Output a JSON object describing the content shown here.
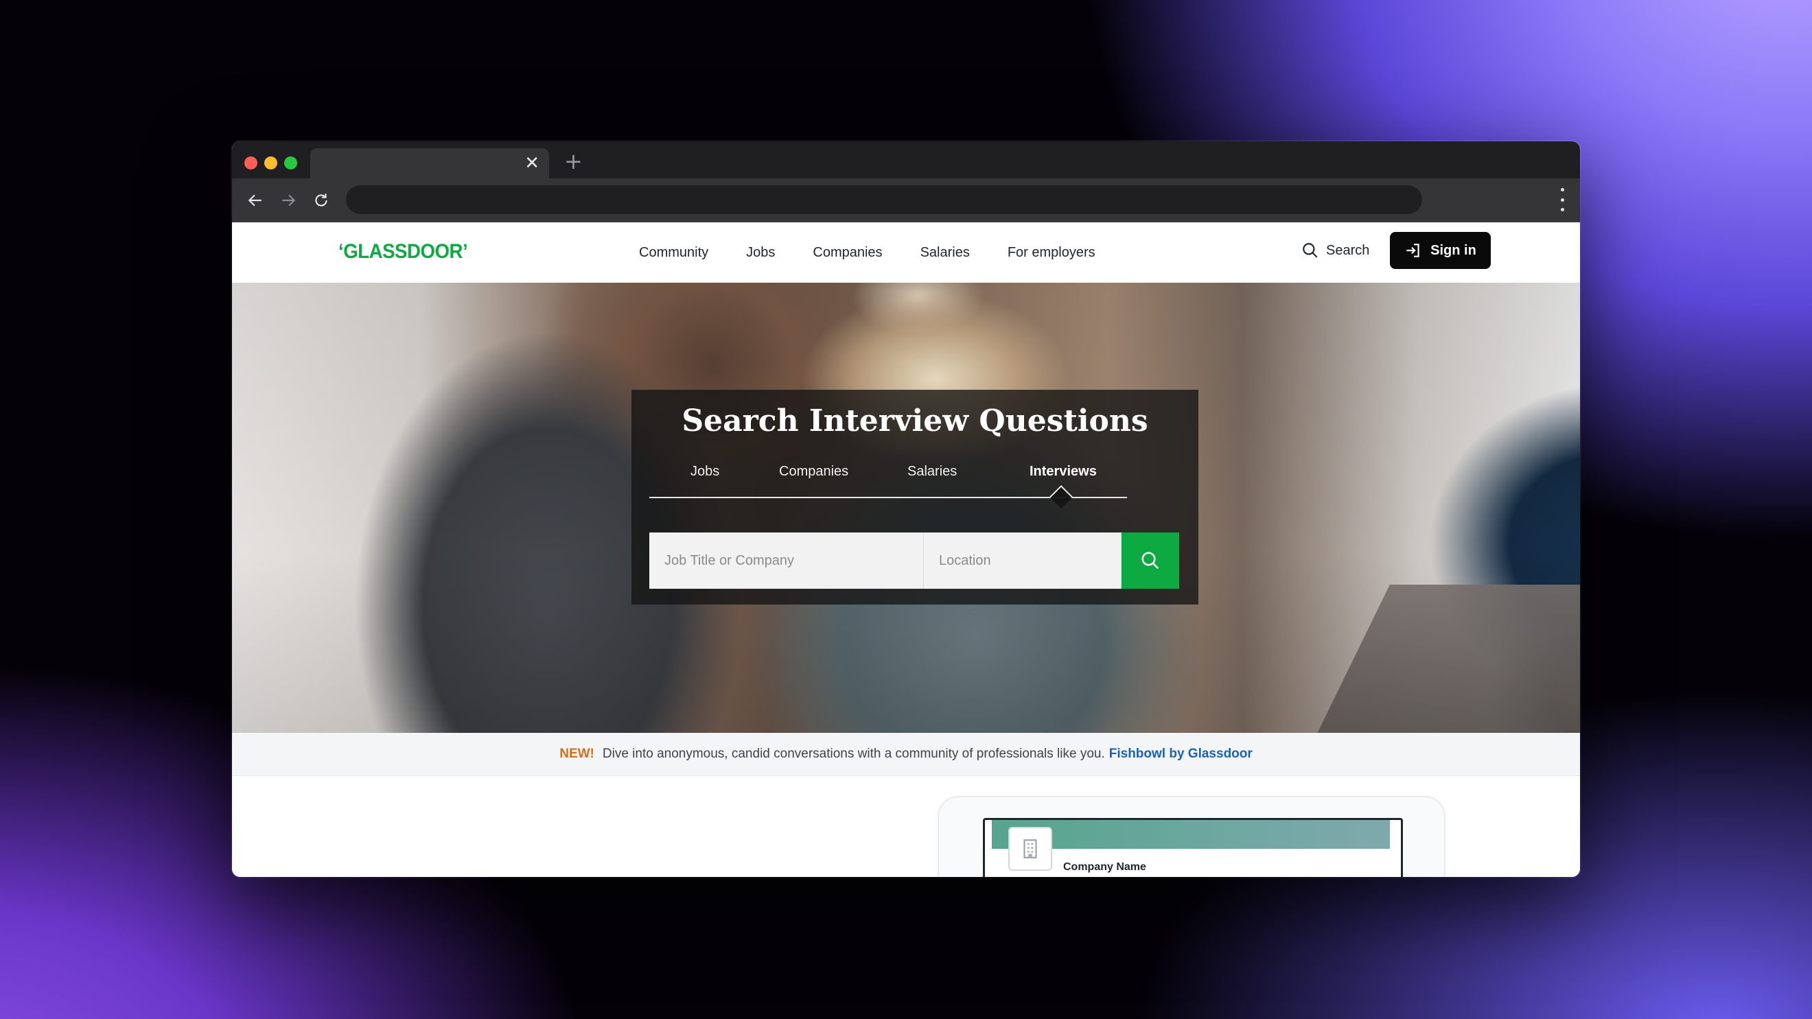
{
  "browser": {
    "tab_close_glyph": "✕",
    "new_tab_glyph": "+",
    "icons": [
      "back-arrow-icon",
      "forward-arrow-icon",
      "reload-icon",
      "kebab-menu-icon"
    ]
  },
  "header": {
    "logo": "GLASSDOOR",
    "nav": [
      "Community",
      "Jobs",
      "Companies",
      "Salaries",
      "For employers"
    ],
    "search_label": "Search",
    "signin_label": "Sign in"
  },
  "hero": {
    "title": "Search Interview Questions",
    "tabs": [
      "Jobs",
      "Companies",
      "Salaries",
      "Interviews"
    ],
    "active_tab": "Interviews",
    "job_placeholder": "Job Title or Company",
    "location_placeholder": "Location"
  },
  "promo": {
    "new_label": "NEW!",
    "text": "Dive into anonymous, candid conversations with a community of professionals like you.",
    "link": "Fishbowl by Glassdoor"
  },
  "preview": {
    "company_name": "Company Name"
  },
  "colors": {
    "brand_green": "#0caa41",
    "new_orange": "#d66f1a",
    "link_blue": "#1861bf"
  }
}
